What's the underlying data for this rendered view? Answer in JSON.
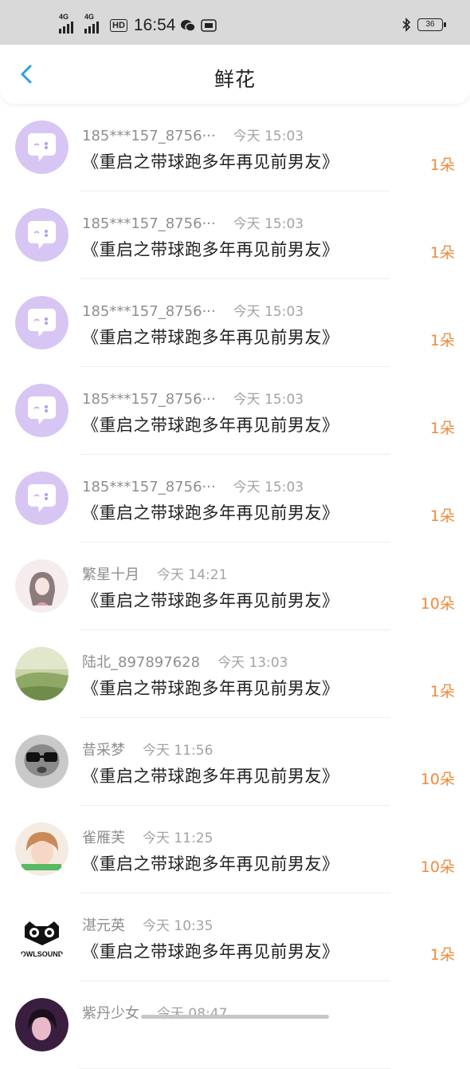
{
  "status_bar": {
    "signal1": "4G",
    "signal2": "4G",
    "hd_label": "HD",
    "time": "16:54",
    "battery": "36"
  },
  "header": {
    "title": "鲜花"
  },
  "gifts": [
    {
      "user": "185***157_8756···",
      "time": "今天 15:03",
      "book": "《重启之带球跑多年再见前男友》",
      "amount": "1朵",
      "avatar": "default-chat-avatar"
    },
    {
      "user": "185***157_8756···",
      "time": "今天 15:03",
      "book": "《重启之带球跑多年再见前男友》",
      "amount": "1朵",
      "avatar": "default-chat-avatar"
    },
    {
      "user": "185***157_8756···",
      "time": "今天 15:03",
      "book": "《重启之带球跑多年再见前男友》",
      "amount": "1朵",
      "avatar": "default-chat-avatar"
    },
    {
      "user": "185***157_8756···",
      "time": "今天 15:03",
      "book": "《重启之带球跑多年再见前男友》",
      "amount": "1朵",
      "avatar": "default-chat-avatar"
    },
    {
      "user": "185***157_8756···",
      "time": "今天 15:03",
      "book": "《重启之带球跑多年再见前男友》",
      "amount": "1朵",
      "avatar": "default-chat-avatar"
    },
    {
      "user": "繁星十月",
      "time": "今天 14:21",
      "book": "《重启之带球跑多年再见前男友》",
      "amount": "10朵",
      "avatar": "anime-girl-avatar"
    },
    {
      "user": "陆北_897897628",
      "time": "今天 13:03",
      "book": "《重启之带球跑多年再见前男友》",
      "amount": "1朵",
      "avatar": "landscape-avatar"
    },
    {
      "user": "昔采梦",
      "time": "今天 11:56",
      "book": "《重启之带球跑多年再见前男友》",
      "amount": "10朵",
      "avatar": "glasses-character-avatar"
    },
    {
      "user": "雀雁芙",
      "time": "今天 11:25",
      "book": "《重启之带球跑多年再见前男友》",
      "amount": "10朵",
      "avatar": "girl-photo-avatar"
    },
    {
      "user": "湛元英",
      "time": "今天 10:35",
      "book": "《重启之带球跑多年再见前男友》",
      "amount": "1朵",
      "avatar": "owl-logo-avatar",
      "avatar_text": "OWLSOUND"
    },
    {
      "user": "紫丹少女",
      "time": "今天 08:47",
      "book": "",
      "amount": "",
      "avatar": "purple-photo-avatar"
    }
  ],
  "colors": {
    "accent": "#f08a3c",
    "back_arrow": "#2a9fe0",
    "default_avatar": "#d7c6f4"
  }
}
